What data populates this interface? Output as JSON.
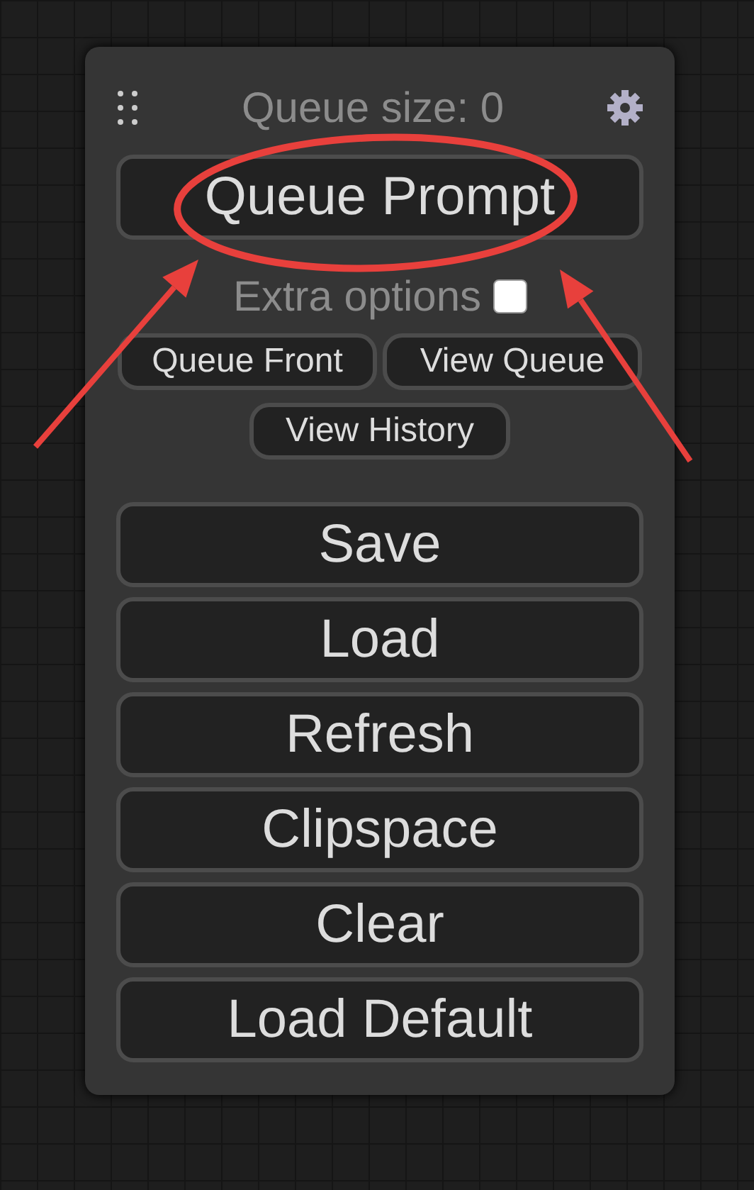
{
  "queue_size": "Queue size: 0",
  "queue_prompt": "Queue Prompt",
  "extra_options": {
    "label": "Extra options",
    "checked": false
  },
  "queue_buttons": [
    "Queue Front",
    "View Queue",
    "View History"
  ],
  "actions": [
    "Save",
    "Load",
    "Refresh",
    "Clipspace",
    "Clear",
    "Load Default"
  ],
  "annotations": [
    {
      "kind": "ellipse"
    },
    {
      "kind": "arrow"
    },
    {
      "kind": "arrow"
    }
  ]
}
